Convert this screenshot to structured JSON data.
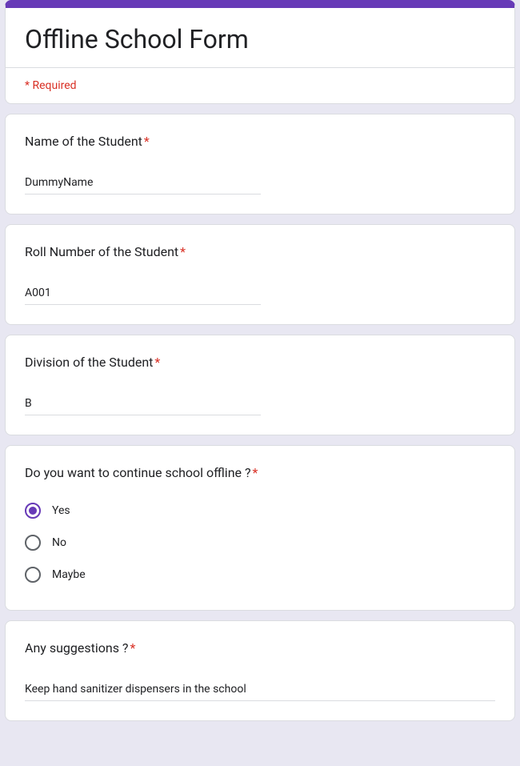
{
  "form": {
    "title": "Offline School Form",
    "required_text": "* Required"
  },
  "questions": {
    "name": {
      "label": "Name of the Student",
      "value": "DummyName"
    },
    "roll": {
      "label": "Roll Number of the Student",
      "value": "A001"
    },
    "division": {
      "label": "Division of the Student",
      "value": "B"
    },
    "continue": {
      "label": "Do you want to continue school offline ?",
      "options": {
        "o0": "Yes",
        "o1": "No",
        "o2": "Maybe"
      },
      "selected": "Yes"
    },
    "suggestions": {
      "label": "Any suggestions ?",
      "value": "Keep hand sanitizer dispensers in the school"
    }
  }
}
